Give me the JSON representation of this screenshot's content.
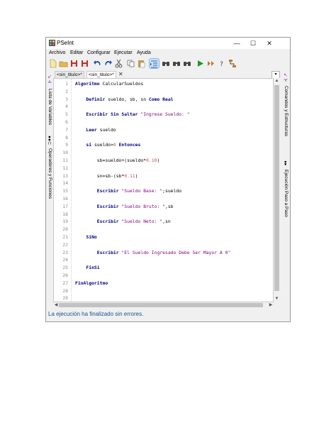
{
  "window": {
    "title": "PSeInt",
    "minimize": "—",
    "maximize": "☐",
    "close": "✕"
  },
  "menu": [
    "Archivo",
    "Editar",
    "Configurar",
    "Ejecutar",
    "Ayuda"
  ],
  "toolbar": [
    {
      "icon": "new-file-icon",
      "color": "#f5e7a8"
    },
    {
      "icon": "open-folder-icon",
      "color": "#e8b94a"
    },
    {
      "icon": "save-icon",
      "color": "#b5302a"
    },
    {
      "icon": "save-as-icon",
      "color": "#b5302a"
    },
    {
      "icon": "undo-icon",
      "color": "#1f4fa8"
    },
    {
      "icon": "redo-icon",
      "color": "#1f4fa8"
    },
    {
      "icon": "cut-icon",
      "color": "#555555"
    },
    {
      "icon": "copy-icon",
      "color": "#5a5a5a"
    },
    {
      "icon": "paste-icon",
      "color": "#c79a4c"
    },
    {
      "icon": "indent-icon",
      "color": "#2f5fae"
    },
    {
      "icon": "find-icon",
      "color": "#444444"
    },
    {
      "icon": "find-prev-icon",
      "color": "#444444"
    },
    {
      "icon": "find-next-icon",
      "color": "#444444"
    },
    {
      "icon": "run-icon",
      "color": "#1c9a2b"
    },
    {
      "icon": "step-icon",
      "color": "#c47a2a"
    },
    {
      "icon": "help-icon",
      "color": "#444444"
    },
    {
      "icon": "flowchart-icon",
      "color": "#c47a2a"
    }
  ],
  "left_panel": {
    "commands": "Lista de Variables",
    "operators": "Operadores y Funciones"
  },
  "right_panel": {
    "commands": "Comandos y Estructuras",
    "step": "Ejecución Paso a Paso"
  },
  "tabs": [
    {
      "label": "<sin_titulo>*"
    },
    {
      "label": "<sin_titulo>*"
    }
  ],
  "tab_close": "✕",
  "code_lines": [
    [
      {
        "t": "kw",
        "v": "Algoritmo "
      },
      {
        "t": "txt",
        "v": "CalcularSueldos"
      }
    ],
    [],
    [
      {
        "t": "txt",
        "v": "    "
      },
      {
        "t": "kw",
        "v": "Definir "
      },
      {
        "t": "txt",
        "v": "sueldo, sb, sn "
      },
      {
        "t": "kw",
        "v": "Como Real"
      }
    ],
    [],
    [
      {
        "t": "txt",
        "v": "    "
      },
      {
        "t": "kw",
        "v": "Escribir Sin Saltar "
      },
      {
        "t": "str",
        "v": "\"Ingrese Sueldo: \""
      }
    ],
    [],
    [
      {
        "t": "txt",
        "v": "    "
      },
      {
        "t": "kw",
        "v": "Leer "
      },
      {
        "t": "txt",
        "v": "sueldo"
      }
    ],
    [],
    [
      {
        "t": "txt",
        "v": "    "
      },
      {
        "t": "kw",
        "v": "si "
      },
      {
        "t": "txt",
        "v": "sueldo>"
      },
      {
        "t": "num",
        "v": "0"
      },
      {
        "t": "kw",
        "v": " Entonces"
      }
    ],
    [],
    [
      {
        "t": "txt",
        "v": "        sb=sueldo+(sueldo*"
      },
      {
        "t": "num",
        "v": "0.10"
      },
      {
        "t": "txt",
        "v": ")"
      }
    ],
    [],
    [
      {
        "t": "txt",
        "v": "        sn=sb-(sb*"
      },
      {
        "t": "num",
        "v": "0.11"
      },
      {
        "t": "txt",
        "v": ")"
      }
    ],
    [],
    [
      {
        "t": "txt",
        "v": "        "
      },
      {
        "t": "kw",
        "v": "Escribir "
      },
      {
        "t": "str",
        "v": "\"Sueldo Base: \""
      },
      {
        "t": "txt",
        "v": ";sueldo"
      }
    ],
    [],
    [
      {
        "t": "txt",
        "v": "        "
      },
      {
        "t": "kw",
        "v": "Escribir "
      },
      {
        "t": "str",
        "v": "\"Sueldo Bruto: \""
      },
      {
        "t": "txt",
        "v": ",sb"
      }
    ],
    [],
    [
      {
        "t": "txt",
        "v": "        "
      },
      {
        "t": "kw",
        "v": "Escribir "
      },
      {
        "t": "str",
        "v": "\"Sueldo Neto: \""
      },
      {
        "t": "txt",
        "v": ",sn"
      }
    ],
    [],
    [
      {
        "t": "txt",
        "v": "    "
      },
      {
        "t": "kw",
        "v": "SiNo"
      }
    ],
    [],
    [
      {
        "t": "txt",
        "v": "        "
      },
      {
        "t": "kw",
        "v": "Escribir "
      },
      {
        "t": "str",
        "v": "\"El Sueldo Ingresado Debe Ser Mayor A 0\""
      }
    ],
    [],
    [
      {
        "t": "txt",
        "v": "    "
      },
      {
        "t": "kw",
        "v": "FinSi"
      }
    ],
    [],
    [
      {
        "t": "kw",
        "v": "FinAlgoritmo"
      }
    ],
    [],
    []
  ],
  "status": "La ejecución ha finalizado sin errores."
}
